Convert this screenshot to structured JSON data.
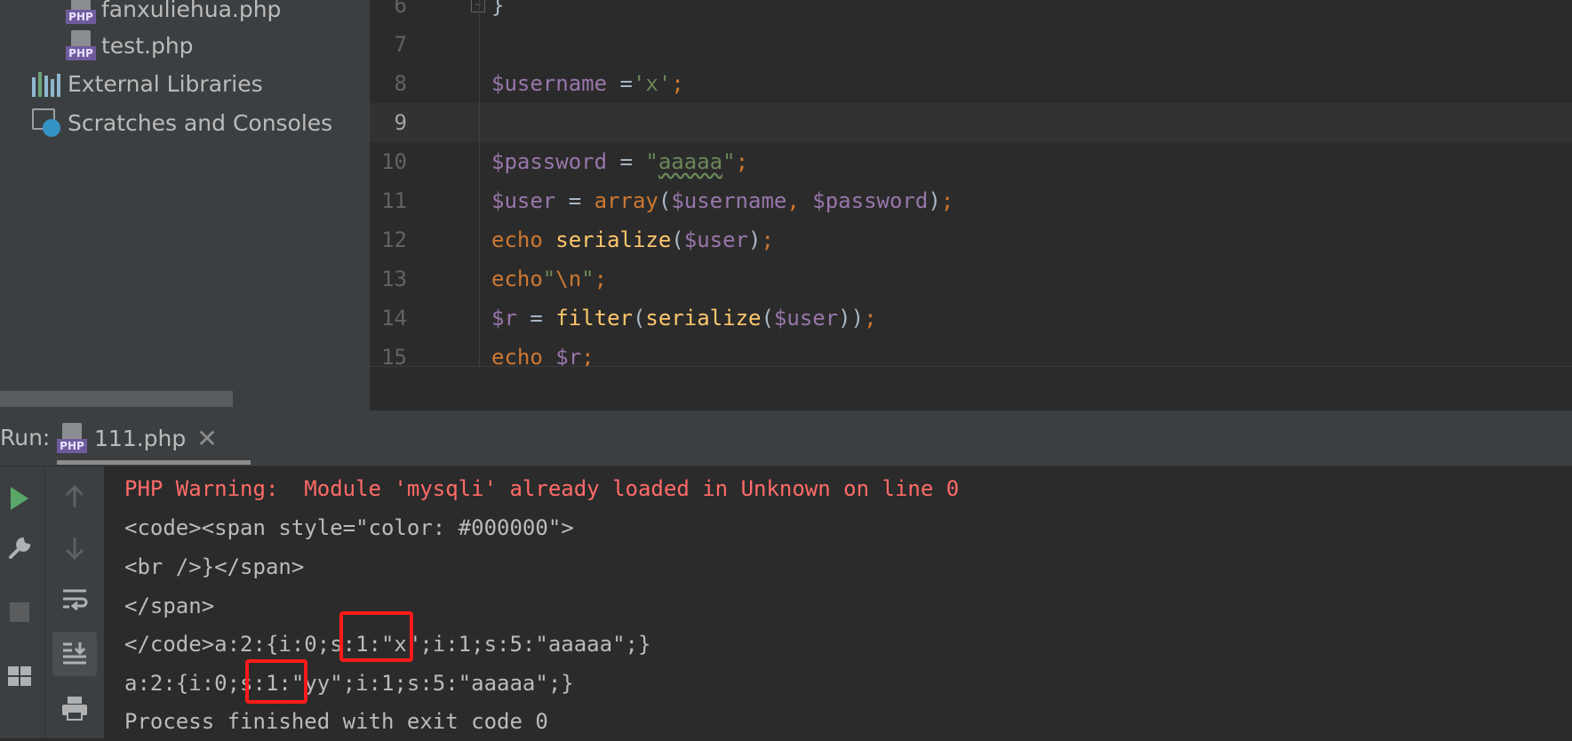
{
  "project_tree": {
    "items": [
      {
        "label": "fanxuliehua.php",
        "icon": "php-file-icon"
      },
      {
        "label": "test.php",
        "icon": "php-file-icon"
      },
      {
        "label": "External Libraries",
        "icon": "external-libraries-icon"
      },
      {
        "label": "Scratches and Consoles",
        "icon": "scratches-icon"
      }
    ],
    "php_badge": "PHP"
  },
  "editor": {
    "fold_glyph": "−",
    "lines": [
      {
        "number": "6",
        "tokens": [
          {
            "text": "}",
            "cls": "plain"
          }
        ]
      },
      {
        "number": "7",
        "tokens": []
      },
      {
        "number": "8",
        "tokens": [
          {
            "text": "$username",
            "cls": "var"
          },
          {
            "text": " =",
            "cls": "plain"
          },
          {
            "text": "'x'",
            "cls": "str"
          },
          {
            "text": ";",
            "cls": "kw"
          }
        ]
      },
      {
        "number": "9",
        "tokens": [],
        "current": true
      },
      {
        "number": "10",
        "tokens": [
          {
            "text": "$password",
            "cls": "var"
          },
          {
            "text": " = ",
            "cls": "plain"
          },
          {
            "text": "\"",
            "cls": "str"
          },
          {
            "text": "aaaaa",
            "cls": "str squiggle"
          },
          {
            "text": "\"",
            "cls": "str"
          },
          {
            "text": ";",
            "cls": "kw"
          }
        ]
      },
      {
        "number": "11",
        "tokens": [
          {
            "text": "$user",
            "cls": "var"
          },
          {
            "text": " = ",
            "cls": "plain"
          },
          {
            "text": "array",
            "cls": "kw"
          },
          {
            "text": "(",
            "cls": "plain"
          },
          {
            "text": "$username",
            "cls": "var"
          },
          {
            "text": ", ",
            "cls": "kw"
          },
          {
            "text": "$password",
            "cls": "var"
          },
          {
            "text": ")",
            "cls": "plain"
          },
          {
            "text": ";",
            "cls": "kw"
          }
        ]
      },
      {
        "number": "12",
        "tokens": [
          {
            "text": "echo ",
            "cls": "kw"
          },
          {
            "text": "serialize",
            "cls": "fn"
          },
          {
            "text": "(",
            "cls": "plain"
          },
          {
            "text": "$user",
            "cls": "var"
          },
          {
            "text": ")",
            "cls": "plain"
          },
          {
            "text": ";",
            "cls": "kw"
          }
        ]
      },
      {
        "number": "13",
        "tokens": [
          {
            "text": "echo",
            "cls": "kw"
          },
          {
            "text": "\"",
            "cls": "str"
          },
          {
            "text": "\\n",
            "cls": "kw"
          },
          {
            "text": "\"",
            "cls": "str"
          },
          {
            "text": ";",
            "cls": "kw"
          }
        ]
      },
      {
        "number": "14",
        "tokens": [
          {
            "text": "$r",
            "cls": "var"
          },
          {
            "text": " = ",
            "cls": "plain"
          },
          {
            "text": "filter",
            "cls": "fn"
          },
          {
            "text": "(",
            "cls": "plain"
          },
          {
            "text": "serialize",
            "cls": "fn"
          },
          {
            "text": "(",
            "cls": "plain"
          },
          {
            "text": "$user",
            "cls": "var"
          },
          {
            "text": "))",
            "cls": "plain"
          },
          {
            "text": ";",
            "cls": "kw"
          }
        ]
      },
      {
        "number": "15",
        "tokens": [
          {
            "text": "echo ",
            "cls": "kw"
          },
          {
            "text": "$r",
            "cls": "var"
          },
          {
            "text": ";",
            "cls": "kw"
          }
        ]
      }
    ]
  },
  "run_panel": {
    "title": "Run:",
    "tab_label": "111.php",
    "tab_close": "✕",
    "toolbar_icons": [
      "run-icon",
      "settings-wrench-icon",
      "stop-icon",
      "layout-icon"
    ],
    "mid_toolbar_icons": [
      "scroll-up-icon",
      "scroll-down-icon",
      "soft-wrap-icon",
      "scroll-to-end-icon",
      "print-icon"
    ],
    "output": [
      "PHP Warning:  Module 'mysqli' already loaded in Unknown on line 0",
      "<code><span style=\"color: #000000\">",
      "<br />}</span>",
      "</span>",
      "</code>a:2:{i:0;s:1:\"x\";i:1;s:5:\"aaaaa\";}",
      "a:2:{i:0;s:1:\"yy\";i:1;s:5:\"aaaaa\";}",
      "Process finished with exit code 0"
    ],
    "colors": {
      "warning": "#ff6b68",
      "highlight_box": "#ff1a1a"
    }
  }
}
